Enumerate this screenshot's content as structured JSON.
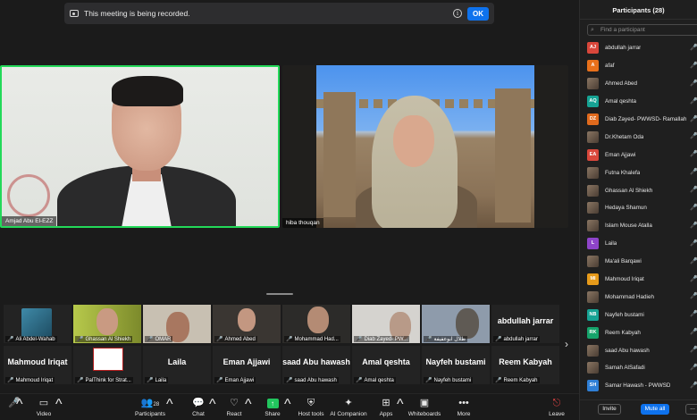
{
  "recording_banner": {
    "text": "This meeting is being recorded.",
    "ok_label": "OK"
  },
  "main_videos": [
    {
      "name": "Amjad Abu El-EZZ"
    },
    {
      "name": "hiba thouqan"
    }
  ],
  "gallery": {
    "row1": [
      {
        "name": "Ali Abdel-Wahab"
      },
      {
        "name": "Ghassan Al Shiekh"
      },
      {
        "name": "OMAR"
      },
      {
        "name": "Ahmed Abed"
      },
      {
        "name": "Mohammad Had..."
      },
      {
        "name": "Diab Zayed- PW..."
      },
      {
        "name": "طلال ابوعفيفة"
      },
      {
        "name": "abdullah jarrar",
        "big": "abdullah jarrar"
      }
    ],
    "row2": [
      {
        "name": "Mahmoud Iriqat",
        "big": "Mahmoud Iriqat"
      },
      {
        "name": "PalThink for Strat..."
      },
      {
        "name": "Laila",
        "big": "Laila"
      },
      {
        "name": "Eman Ajjawi",
        "big": "Eman Ajjawi"
      },
      {
        "name": "saad Abu hawash",
        "big": "saad Abu hawash"
      },
      {
        "name": "Amal qeshta",
        "big": "Amal qeshta"
      },
      {
        "name": "Nayfeh bustami",
        "big": "Nayfeh bustami"
      },
      {
        "name": "Reem Kabyah",
        "big": "Reem Kabyah"
      }
    ],
    "next_icon": "chevron-right-icon"
  },
  "toolbar": {
    "audio": "Audio",
    "video": "Video",
    "participants": "Participants",
    "participants_count": "28",
    "chat": "Chat",
    "react": "React",
    "share": "Share",
    "host_tools": "Host tools",
    "ai_companion": "AI Companion",
    "apps": "Apps",
    "whiteboards": "Whiteboards",
    "more": "More",
    "leave": "Leave"
  },
  "panel": {
    "title": "Participants (28)",
    "search_placeholder": "Find a participant",
    "invite_label": "Invite",
    "mute_all_label": "Mute all",
    "more_label": "...",
    "participants": [
      {
        "initials": "AJ",
        "name": "abdullah jarrar",
        "color": "#d9473b"
      },
      {
        "initials": "A",
        "name": "afaf",
        "color": "#e8701a"
      },
      {
        "initials": "",
        "name": "Ahmed Abed",
        "color": "photo"
      },
      {
        "initials": "AQ",
        "name": "Amal qeshta",
        "color": "#16a394"
      },
      {
        "initials": "DZ",
        "name": "Diab Zayed- PWWSD- Ramallah",
        "color": "#e06a1d"
      },
      {
        "initials": "",
        "name": "Dr.Khetam Oda",
        "color": "photo"
      },
      {
        "initials": "EA",
        "name": "Eman Ajjawi",
        "color": "#d9473b"
      },
      {
        "initials": "",
        "name": "Futna Khalefa",
        "color": "photo"
      },
      {
        "initials": "",
        "name": "Ghassan Al Shiekh",
        "color": "photo"
      },
      {
        "initials": "",
        "name": "Hedaya Shamun",
        "color": "photo"
      },
      {
        "initials": "",
        "name": "Islam Mouse Atalla",
        "color": "photo"
      },
      {
        "initials": "L",
        "name": "Laila",
        "color": "#8e44c9"
      },
      {
        "initials": "",
        "name": "Ma'ali Barqawi",
        "color": "photo"
      },
      {
        "initials": "MI",
        "name": "Mahmoud Iriqat",
        "color": "#e69a1a"
      },
      {
        "initials": "",
        "name": "Mohammad Hadieh",
        "color": "photo"
      },
      {
        "initials": "NB",
        "name": "Nayfeh bustami",
        "color": "#16a394"
      },
      {
        "initials": "RK",
        "name": "Reem Kabyah",
        "color": "#16a36b"
      },
      {
        "initials": "",
        "name": "saad Abu hawash",
        "color": "photo"
      },
      {
        "initials": "",
        "name": "Samah AlSafadi",
        "color": "photo"
      },
      {
        "initials": "SH",
        "name": "Samar Hawash - PWWSD",
        "color": "#2f7fd6"
      }
    ]
  }
}
